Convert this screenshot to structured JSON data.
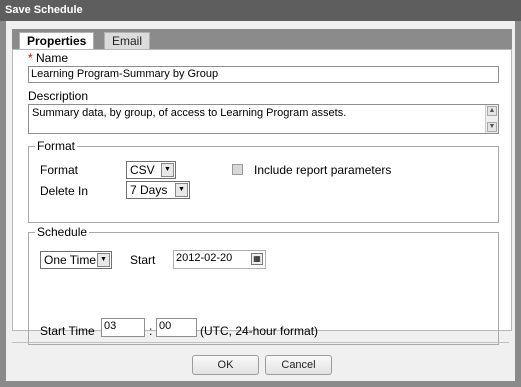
{
  "window": {
    "title": "Save Schedule"
  },
  "tabs": [
    {
      "label": "Properties",
      "active": true
    },
    {
      "label": "Email",
      "active": false
    }
  ],
  "name": {
    "required_mark": "*",
    "label": "Name",
    "value": "Learning Program-Summary by Group"
  },
  "description": {
    "label": "Description",
    "value": "Summary data, by group, of access to Learning Program assets."
  },
  "format_group": {
    "legend": "Format",
    "format_label": "Format",
    "format_value": "CSV",
    "delete_label": "Delete In",
    "delete_value": "7 Days",
    "include_params_label": "Include report parameters",
    "include_params_checked": false
  },
  "schedule_group": {
    "legend": "Schedule",
    "frequency_value": "One Time",
    "start_label": "Start",
    "start_date": "2012-02-20",
    "start_time_label": "Start Time",
    "hour": "03",
    "colon": ":",
    "minute": "00",
    "time_note": "(UTC, 24-hour format)"
  },
  "buttons": {
    "ok": "OK",
    "cancel": "Cancel"
  },
  "colors": {
    "titlebar": "#5e5e5e",
    "frame": "#8a8a8a",
    "required": "#dd0000"
  }
}
